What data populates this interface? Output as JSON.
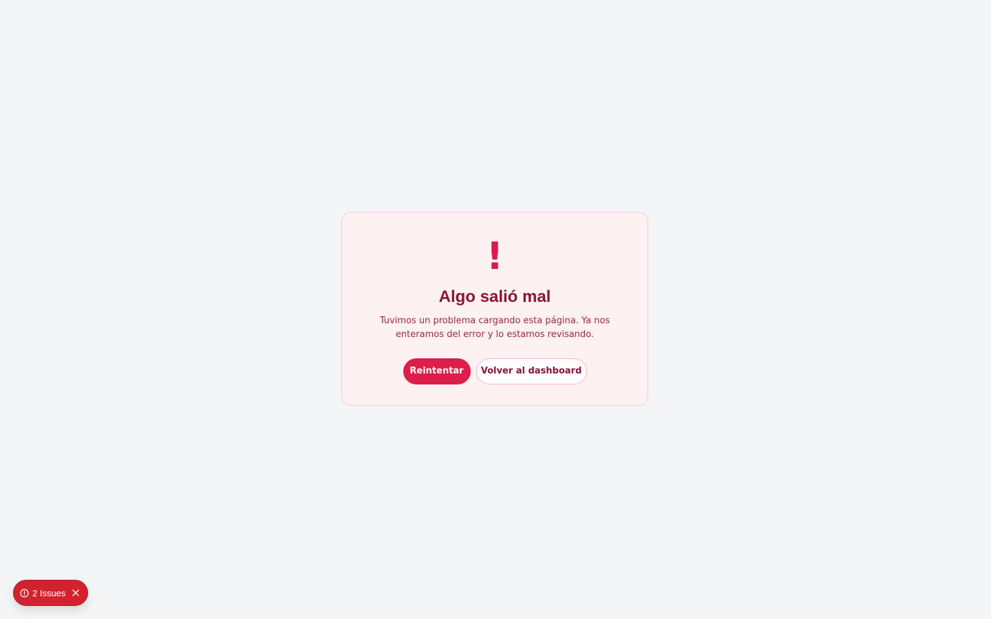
{
  "error_card": {
    "icon": "exclamation-icon",
    "icon_glyph": "!",
    "title": "Algo salió mal",
    "message": "Tuvimos un problema cargando esta página. Ya nos enteramos del error y lo estamos revisando.",
    "retry_label": "Reintentar",
    "dashboard_label": "Volver al dashboard"
  },
  "issues_badge": {
    "label": "2 Issues",
    "icon": "alert-circle-icon",
    "close_icon": "close-icon"
  },
  "colors": {
    "page_background": "#f4f5f7",
    "card_background": "#fdf1f2",
    "accent": "#dc1e4b",
    "title": "#8a1538",
    "issues_badge": "#d3222f"
  }
}
